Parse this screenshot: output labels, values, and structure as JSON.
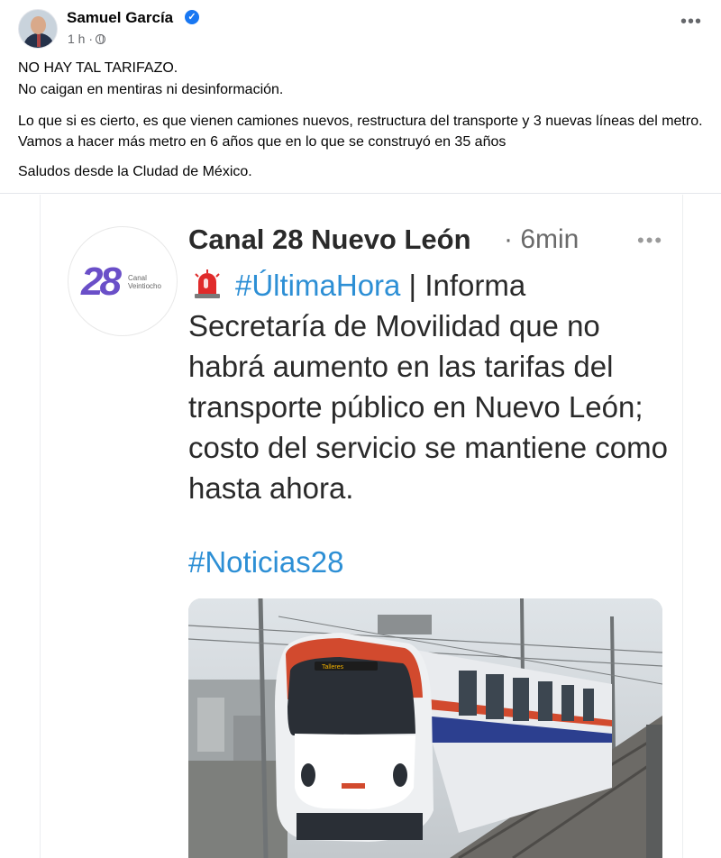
{
  "post": {
    "author": "Samuel García",
    "verified_mark": "✓",
    "time": "1 h ·",
    "more_label": "•••",
    "lines": [
      "NO HAY TAL TARIFAZO.",
      "No caigan en mentiras ni desinformación.",
      "Lo que si es cierto, es que vienen camiones nuevos, restructura del transporte y 3 nuevas líneas del metro. Vamos a hacer más metro en 6 años que en lo que se construyó en 35 años",
      "Saludos desde la Cludad de México."
    ]
  },
  "tweet": {
    "logo_number": "28",
    "logo_sub_1": "Canal",
    "logo_sub_2": "Veintiocho",
    "name": "Canal 28 Nuevo León",
    "time": "· 6min",
    "more_label": "•••",
    "hashtag_1": "#ÚltimaHora",
    "separator": " | ",
    "body_first": "Informa",
    "body_rest": "Secretaría de Movilidad que no habrá aumento en las tarifas del transporte público en Nuevo León; costo del servicio se mantiene como hasta ahora.",
    "hashtag_2": "#Noticias28",
    "train_sign": "Talleres"
  },
  "icons": [
    "avatar",
    "verified-badge-icon",
    "globe-icon",
    "more-icon",
    "siren-icon",
    "channel-logo",
    "train-photo"
  ],
  "colors": {
    "facebook_blue": "#1877f2",
    "hashtag_blue": "#2d8fd5",
    "secondary_text": "#65676b"
  }
}
